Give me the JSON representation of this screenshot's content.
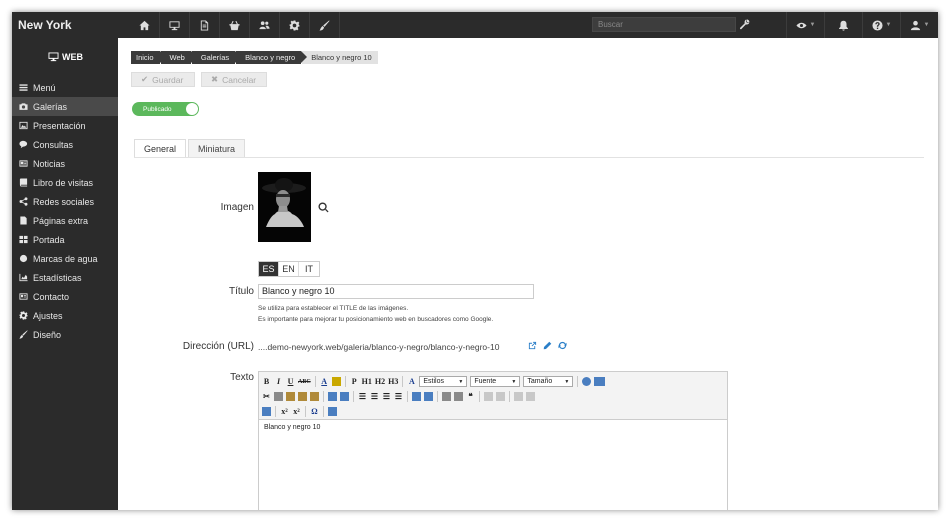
{
  "app": {
    "title": "New York"
  },
  "topbar": {
    "icons": [
      "home-icon",
      "monitor-icon",
      "file-icon",
      "basket-icon",
      "users-icon",
      "gear-icon",
      "brush-icon"
    ],
    "search_placeholder": "Buscar",
    "right": [
      "eye-icon",
      "bell-icon",
      "help-icon",
      "user-icon"
    ]
  },
  "sidebar": {
    "logo": "WEB",
    "items": [
      {
        "label": "Menú",
        "icon": "menu-icon",
        "active": false
      },
      {
        "label": "Galerías",
        "icon": "camera-icon",
        "active": true
      },
      {
        "label": "Presentación",
        "icon": "picture-icon",
        "active": false
      },
      {
        "label": "Consultas",
        "icon": "comments-icon",
        "active": false
      },
      {
        "label": "Noticias",
        "icon": "newspaper-icon",
        "active": false
      },
      {
        "label": "Libro de visitas",
        "icon": "book-icon",
        "active": false
      },
      {
        "label": "Redes sociales",
        "icon": "share-icon",
        "active": false
      },
      {
        "label": "Páginas extra",
        "icon": "file-icon",
        "active": false
      },
      {
        "label": "Portada",
        "icon": "grid-icon",
        "active": false
      },
      {
        "label": "Marcas de agua",
        "icon": "drop-icon",
        "active": false
      },
      {
        "label": "Estadísticas",
        "icon": "chart-icon",
        "active": false
      },
      {
        "label": "Contacto",
        "icon": "card-icon",
        "active": false
      },
      {
        "label": "Ajustes",
        "icon": "gear-icon",
        "active": false
      },
      {
        "label": "Diseño",
        "icon": "brush-icon",
        "active": false
      }
    ]
  },
  "breadcrumb": [
    "Inicio",
    "Web",
    "Galerías",
    "Blanco y negro",
    "Blanco y negro 10"
  ],
  "actions": {
    "save": "Guardar",
    "cancel": "Cancelar"
  },
  "status": {
    "label": "Publicado",
    "on": true
  },
  "tabs": [
    {
      "label": "General",
      "active": true
    },
    {
      "label": "Miniatura",
      "active": false
    }
  ],
  "form": {
    "image_label": "Imagen",
    "languages": [
      {
        "code": "ES",
        "active": true
      },
      {
        "code": "EN",
        "active": false
      },
      {
        "code": "IT",
        "active": false
      }
    ],
    "title_label": "Título",
    "title_value": "Blanco y negro 10",
    "help_1": "Se utiliza para establecer el TITLE de las imágenes.",
    "help_2": "Es importante para mejorar tu posicionamiento web en buscadores como Google.",
    "url_label": "Dirección (URL)",
    "url_value": "....demo-newyork.web/galeria/blanco-y-negro/blanco-y-negro-10",
    "text_label": "Texto",
    "editor": {
      "styles": "Estilos",
      "font": "Fuente",
      "size": "Tamaño",
      "content": "Blanco y negro 10"
    }
  },
  "colors": {
    "dark": "#2b2b2b",
    "toggle": "#5cb85c",
    "link": "#2a7fc8"
  }
}
